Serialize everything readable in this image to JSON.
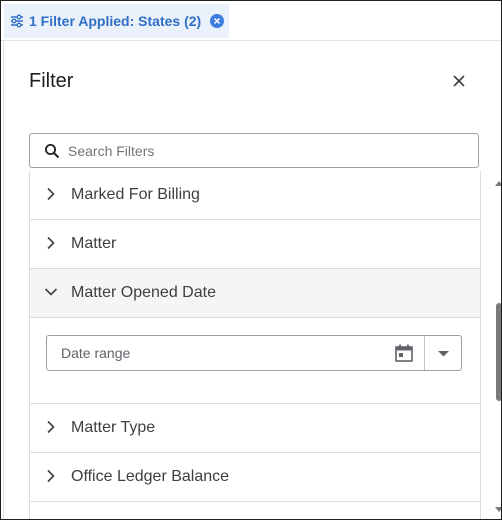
{
  "chip": {
    "label": "1 Filter Applied: States (2)"
  },
  "panel": {
    "title": "Filter"
  },
  "search": {
    "placeholder": "Search Filters"
  },
  "filters": [
    {
      "label": "Marked For Billing",
      "expanded": false
    },
    {
      "label": "Matter",
      "expanded": false
    },
    {
      "label": "Matter Opened Date",
      "expanded": true
    },
    {
      "label": "Matter Type",
      "expanded": false
    },
    {
      "label": "Office Ledger Balance",
      "expanded": false
    }
  ],
  "date_range": {
    "placeholder": "Date range"
  },
  "icons": {
    "chip": "filter-sliders-icon",
    "chip_clear": "close-circle-icon",
    "close": "close-icon",
    "search": "search-icon",
    "collapsed": "chevron-right-icon",
    "expanded": "chevron-down-icon",
    "calendar": "calendar-icon",
    "dropdown": "caret-down-icon"
  },
  "colors": {
    "accent": "#2f6fc5",
    "chip_bg": "#eaf1fb",
    "clear_button": "#3d7de0",
    "expanded_row_bg": "#f5f5f5"
  }
}
